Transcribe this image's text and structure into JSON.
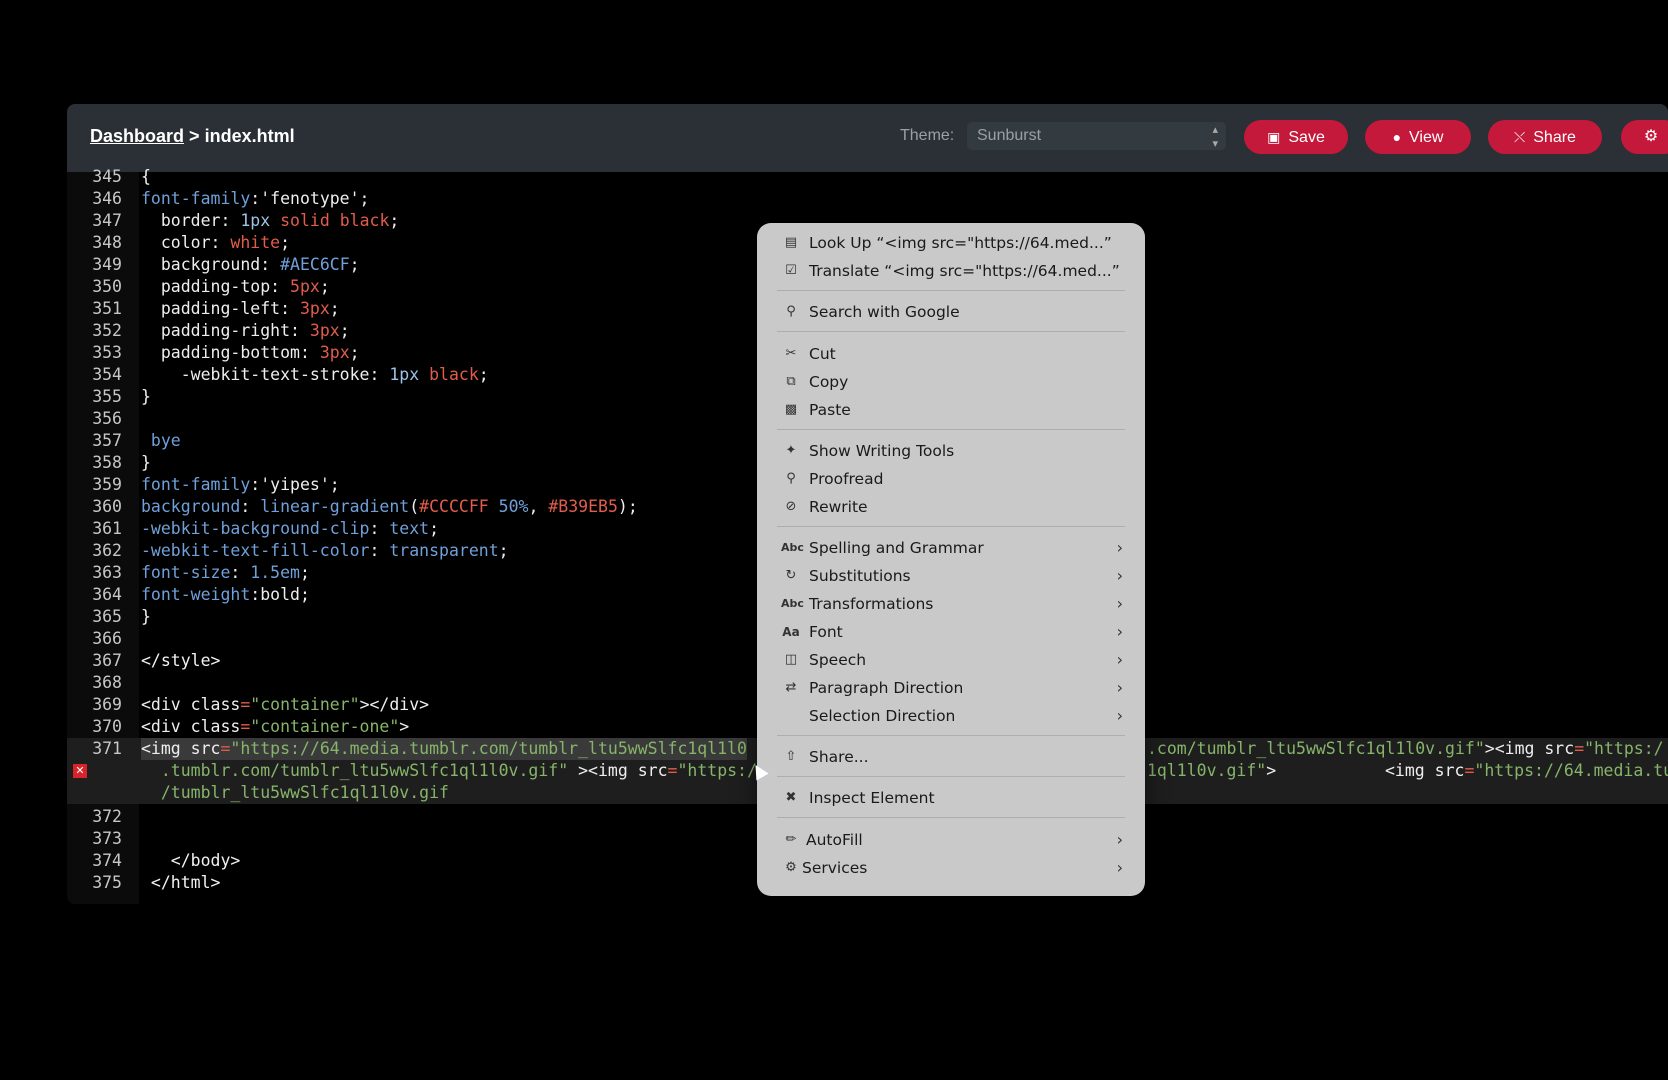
{
  "breadcrumb": {
    "dashboard": "Dashboard",
    "separator": ">",
    "file": "index.html"
  },
  "theme": {
    "label": "Theme:",
    "value": "Sunburst"
  },
  "buttons": {
    "save": "Save",
    "view": "View",
    "share": "Share"
  },
  "colors": {
    "accent": "#c4193b",
    "header": "#2a3035",
    "menu": "#c9c9c9"
  },
  "code": {
    "l345": "345",
    "l346": "346",
    "l347": "347",
    "l348": "348",
    "l349": "349",
    "l350": "350",
    "l351": "351",
    "l352": "352",
    "l353": "353",
    "l354": "354",
    "l355": "355",
    "l356": "356",
    "l357": "357",
    "l358": "358",
    "l359": "359",
    "l360": "360",
    "l361": "361",
    "l362": "362",
    "l363": "363",
    "l364": "364",
    "l365": "365",
    "l366": "366",
    "l367": "367",
    "l368": "368",
    "l369": "369",
    "l370": "370",
    "l371": "371",
    "l372": "372",
    "l373": "373",
    "l374": "374",
    "l375": "375",
    "c345": "{",
    "c346a": "font-family",
    "c346b": ":'fenotype';",
    "c347a": "  border",
    "c347b": ": ",
    "c347c": "1px",
    "c347d": " solid ",
    "c347e": "black",
    "c347f": ";",
    "c348a": "  color",
    "c348b": ": ",
    "c348c": "white",
    "c348d": ";",
    "c349a": "  background",
    "c349b": ": ",
    "c349c": "#AEC6CF",
    "c349d": ";",
    "c350a": "  padding-top",
    "c350b": ": ",
    "c350c": "5px",
    "c350d": ";",
    "c351a": "  padding-left",
    "c351b": ": ",
    "c351c": "3px",
    "c351d": ";",
    "c352a": "  padding-right",
    "c352b": ": ",
    "c352c": "3px",
    "c352d": ";",
    "c353a": "  padding-bottom",
    "c353b": ": ",
    "c353c": "3px",
    "c353d": ";",
    "c354a": "    -webkit-text-stroke",
    "c354b": ": ",
    "c354c": "1px",
    "c354d": " ",
    "c354e": "black",
    "c354f": ";",
    "c355": "}",
    "c357": " bye",
    "c358": "}",
    "c359a": "font-family",
    "c359b": ":'yipes';",
    "c360a": "background",
    "c360b": ": ",
    "c360c": "linear-gradient",
    "c360d": "(",
    "c360e": "#CCCCFF",
    "c360f": " ",
    "c360g": "50%",
    "c360h": ", ",
    "c360i": "#B39EB5",
    "c360j": ");",
    "c361a": "-webkit-background-clip",
    "c361b": ": ",
    "c361c": "text",
    "c361d": ";",
    "c362a": "-webkit-text-fill-color",
    "c362b": ": ",
    "c362c": "transparent",
    "c362d": ";",
    "c363a": "font-size",
    "c363b": ": ",
    "c363c": "1.5em",
    "c363d": ";",
    "c364a": "font-weight",
    "c364b": ":bold;",
    "c365": "}",
    "c367": "</style>",
    "c369a": "<div ",
    "c369b": "class",
    "c369c": "=",
    "c369d": "\"container\"",
    "c369e": "></div>",
    "c370a": "<div ",
    "c370b": "class",
    "c370c": "=",
    "c370d": "\"container-one\"",
    "c370e": ">",
    "c371a": "<img ",
    "c371b": "src",
    "c371c": "=",
    "c371d": "\"https://64.media.tumblr.com/tumblr_ltu5wwSlfc1ql1l0",
    "c371e": ".com/tumblr_ltu5wwSlfc1ql1l0v.gif\"",
    "c371f": "><img ",
    "c371g": "src",
    "c371h": "=",
    "c371i": "\"https:/",
    "c371w1a": "  .tumblr.com/tumblr_ltu5wwSlfc1ql1l0v.gif\"",
    "c371w1b": " ><img ",
    "c371w1c": "src",
    "c371w1d": "=",
    "c371w1e": "\"https:/",
    "c371w1f": "1ql1l0v.gif\"",
    "c371w1g": ">",
    "c371w1h": "<img ",
    "c371w1i": "src",
    "c371w1j": "=",
    "c371w1k": "\"https://64.media.tu",
    "c371w2": "  /tumblr_ltu5wwSlfc1ql1l0v.gif",
    "c374": "   </body>",
    "c375": " </html>"
  },
  "context_menu": {
    "look_up": "Look Up “<img src=\"https://64.med...”",
    "translate": "Translate “<img src=\"https://64.med...”",
    "search_google": "Search with Google",
    "cut": "Cut",
    "copy": "Copy",
    "paste": "Paste",
    "show_writing_tools": "Show Writing Tools",
    "proofread": "Proofread",
    "rewrite": "Rewrite",
    "spelling": "Spelling and Grammar",
    "substitutions": "Substitutions",
    "transformations": "Transformations",
    "font": "Font",
    "speech": "Speech",
    "paragraph_direction": "Paragraph Direction",
    "selection_direction": "Selection Direction",
    "share": "Share...",
    "inspect": "Inspect Element",
    "autofill": "AutoFill",
    "services": "Services",
    "abc": "Abc",
    "aa": "Aa"
  }
}
